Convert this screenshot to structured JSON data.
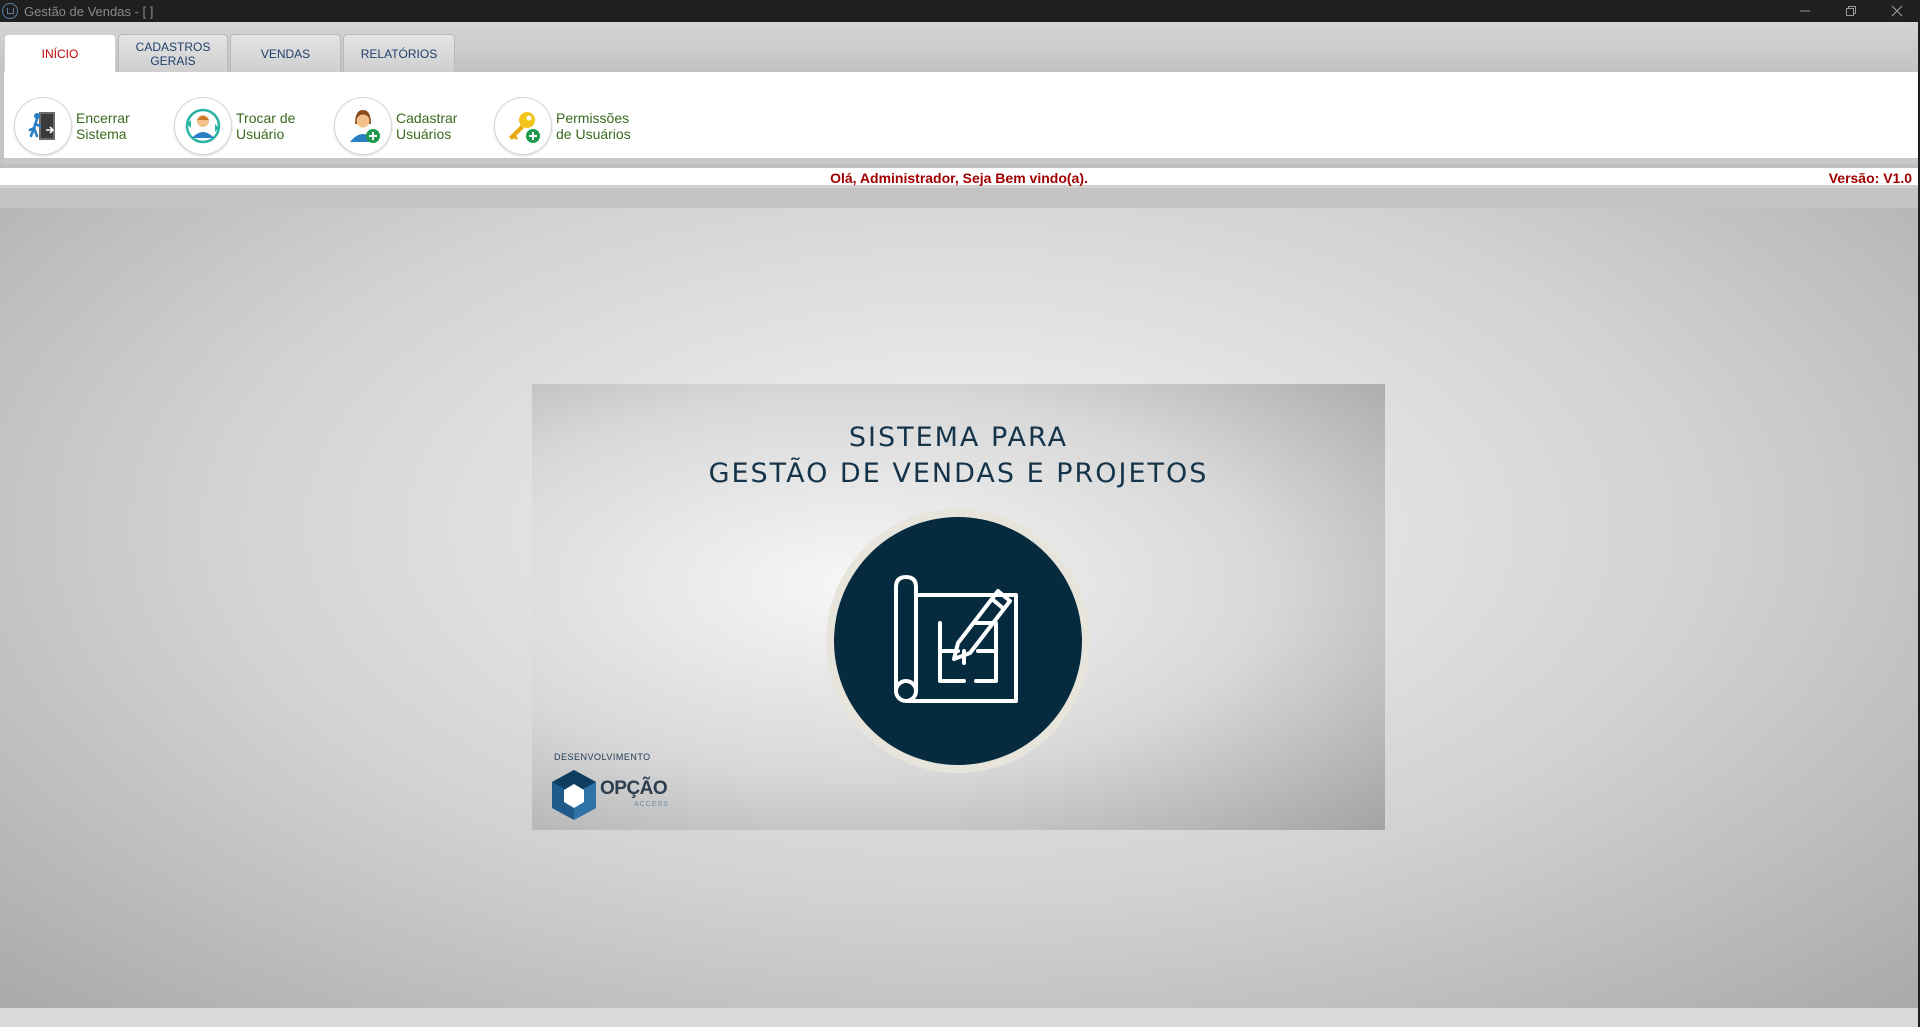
{
  "window": {
    "title": "Gestão de Vendas - [ ]",
    "controls": {
      "minimize_icon": "minimize-icon",
      "restore_icon": "restore-icon",
      "close_icon": "close-icon"
    }
  },
  "tabs": [
    {
      "label": "INÍCIO",
      "active": true
    },
    {
      "label_line1": "CADASTROS",
      "label_line2": "GERAIS",
      "active": false
    },
    {
      "label": "VENDAS",
      "active": false
    },
    {
      "label": "RELATÓRIOS",
      "active": false
    }
  ],
  "ribbon": {
    "buttons": [
      {
        "line1": "Encerrar",
        "line2": "Sistema",
        "icon": "exit-door-icon"
      },
      {
        "line1": "Trocar de",
        "line2": "Usuário",
        "icon": "switch-user-icon"
      },
      {
        "line1": "Cadastrar",
        "line2": "Usuários",
        "icon": "add-user-icon"
      },
      {
        "line1": "Permissões",
        "line2": "de Usuários",
        "icon": "key-permission-icon"
      }
    ]
  },
  "status": {
    "welcome": "Olá, Administrador, Seja Bem vindo(a).",
    "version": "Versão: V1.0"
  },
  "splash": {
    "title_line1": "SISTEMA PARA",
    "title_line2": "GESTÃO DE VENDAS E PROJETOS",
    "emblem_icon": "blueprint-pencil-icon",
    "dev_label": "DESENVOLVIMENTO",
    "logo_text": "OPÇÃO",
    "logo_sub": "ACCESS"
  },
  "colors": {
    "accent_red": "#c00000",
    "ribbon_green": "#3a6a1e",
    "tab_blue": "#1f3f6b",
    "emblem_navy": "#062b3e"
  }
}
